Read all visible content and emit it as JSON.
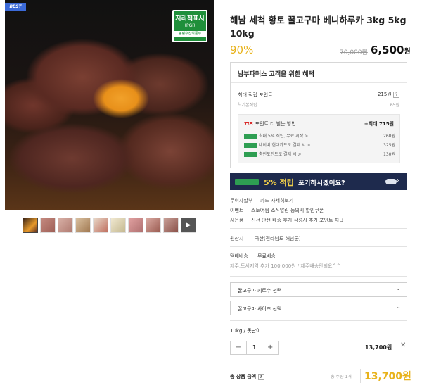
{
  "badge": "BEST",
  "seal": {
    "title": "지리적표시",
    "sub": "(PGI)",
    "footer": "농림수산식품부"
  },
  "product": {
    "title": "해남 세척 황토 꿀고구마 베니하루카 3kg 5kg 10kg",
    "discount": "90%",
    "old_price": "70,000원",
    "sale_price_num": "6,500",
    "sale_price_unit": "원"
  },
  "benefit": {
    "title": "남부파머스 고객을 위한 혜택",
    "max_label": "최대 적립 포인트",
    "max_value": "215원",
    "basic_label": "기본적립",
    "basic_value": "65원",
    "tip_prefix": "TIP.",
    "tip_label": "포인트 더 받는 방법",
    "tip_max": "+최대 715원",
    "rows": [
      {
        "label": "최대 5% 적립, 무료 시작 >",
        "value": "260원",
        "color": "#2e9e52"
      },
      {
        "label": "네이버 현대카드로 결제 시 >",
        "value": "325원",
        "color": "#2e9e52"
      },
      {
        "label": "충전포인트로 결제 시 >",
        "value": "130원",
        "color": "#2e9e52"
      }
    ]
  },
  "naver_banner": {
    "pct": "5% 적립",
    "msg": "포기하시겠어요?",
    "arrow": "›"
  },
  "info": {
    "installment_label": "무이자할부",
    "installment_value": "카드 자세히보기",
    "event_label": "이벤트",
    "event_value": "스토어찜 소식알림 동의시 할인쿠폰",
    "gift_label": "사은품",
    "gift_value": "신선 안전 배송 후기 작성시 추가 포인트 지급",
    "origin_label": "원산지",
    "origin_value": "국산(전라남도 해남군)",
    "delivery_label": "택배배송",
    "delivery_value": "무료배송",
    "delivery_note": "제주,도서지역 추가 100,000원 / 제주배송안되요^^"
  },
  "options": {
    "select1": "꿀고구마 키로수 선택",
    "select2": "꿀고구마 사이즈 선택"
  },
  "selected": {
    "name": "10kg / 못난이",
    "qty": "1",
    "minus": "−",
    "plus": "+",
    "price": "13,700원",
    "remove": "✕"
  },
  "total": {
    "label": "총 상품 금액",
    "qty_text": "총 수량 1개",
    "price": "13,700원"
  },
  "thumbs_count": 10
}
